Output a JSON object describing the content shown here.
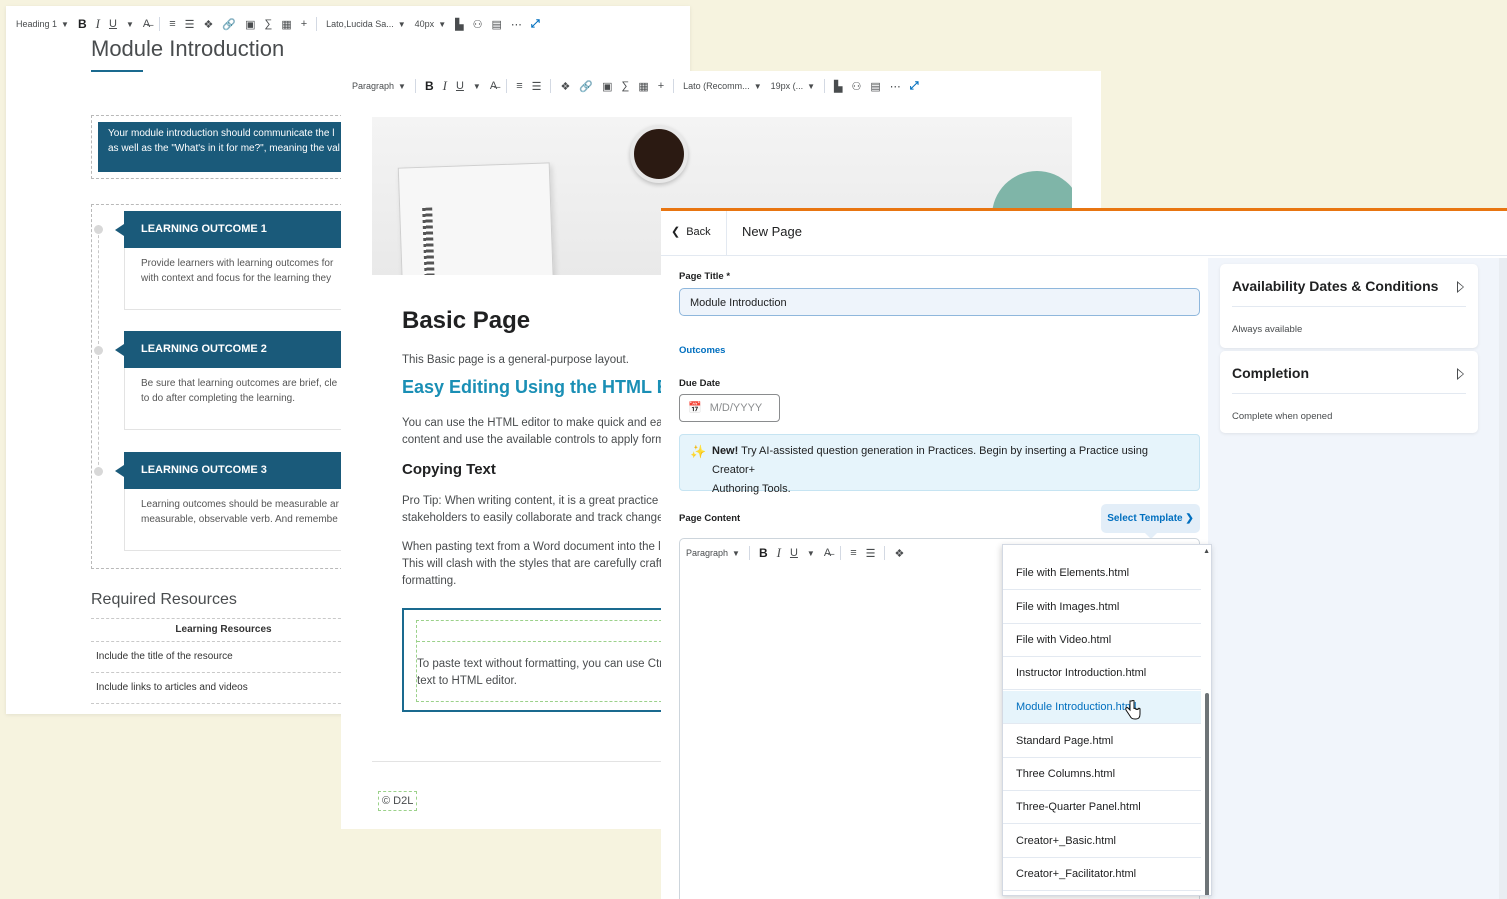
{
  "win1": {
    "toolbar": {
      "block": "Heading 1",
      "font": "Lato,Lucida Sa...",
      "size": "40px"
    },
    "title": "Module Introduction",
    "callout": [
      "Your module introduction should communicate the l",
      "as well as the \"What's in it for me?\", meaning the val"
    ],
    "outcomes": [
      {
        "head": "LEARNING OUTCOME 1",
        "body": [
          "Provide learners with learning outcomes for",
          "with context and focus for the learning they"
        ]
      },
      {
        "head": "LEARNING OUTCOME 2",
        "body": [
          "Be sure that learning outcomes are brief, cle",
          "to do after completing the learning."
        ]
      },
      {
        "head": "LEARNING OUTCOME 3",
        "body": [
          "Learning outcomes should be measurable ar",
          "measurable, observable verb. And remembe"
        ]
      }
    ],
    "resources_title": "Required Resources",
    "table_header": "Learning Resources",
    "table_rows": [
      "Include the title of the resource",
      "Include links to articles and videos"
    ]
  },
  "win2": {
    "toolbar": {
      "block": "Paragraph",
      "font": "Lato (Recomm...",
      "size": "19px (..."
    },
    "heading": "Basic Page",
    "intro": "This Basic page is a general-purpose layout.",
    "subheading": "Easy Editing Using the HTML Ed",
    "p1": [
      "You can use the HTML editor to make quick and eas",
      "content and use the available controls to apply form"
    ],
    "copying": "Copying Text",
    "p2": [
      "Pro Tip: When writing content, it is a great practice",
      "stakeholders to easily collaborate and track changes"
    ],
    "p3": [
      "When pasting text from a Word document into the l",
      "This will clash with the styles that are carefully craft",
      "formatting."
    ],
    "tip": [
      "To paste text without formatting, you can use Ctr",
      "text to HTML editor."
    ],
    "copyright": "© D2L"
  },
  "win3": {
    "back": "Back",
    "page_title": "New Page",
    "title_label": "Page Title *",
    "title_value": "Module Introduction",
    "outcomes": "Outcomes",
    "due_label": "Due Date",
    "due_placeholder": "M/D/YYYY",
    "alert_bold": "New!",
    "alert_text": " Try AI-assisted question generation in Practices. Begin by inserting a Practice using Creator+",
    "alert_text2": "Authoring Tools.",
    "content_label": "Page Content",
    "select_template": "Select Template",
    "editor_block": "Paragraph",
    "cards": [
      {
        "title": "Availability Dates & Conditions",
        "sub": "Always available"
      },
      {
        "title": "Completion",
        "sub": "Complete when opened"
      }
    ]
  },
  "dropdown": {
    "items": [
      "File with Elements.html",
      "File with Images.html",
      "File with Video.html",
      "Instructor Introduction.html",
      "Module Introduction.html",
      "Standard Page.html",
      "Three Columns.html",
      "Three-Quarter Panel.html",
      "Creator+_Basic.html",
      "Creator+_Facilitator.html"
    ],
    "selected": "Module Introduction.html"
  },
  "colors": {
    "accent": "#006fbf",
    "header": "#1a5a7a",
    "orange": "#e87511",
    "teal": "#1a8fb5"
  }
}
